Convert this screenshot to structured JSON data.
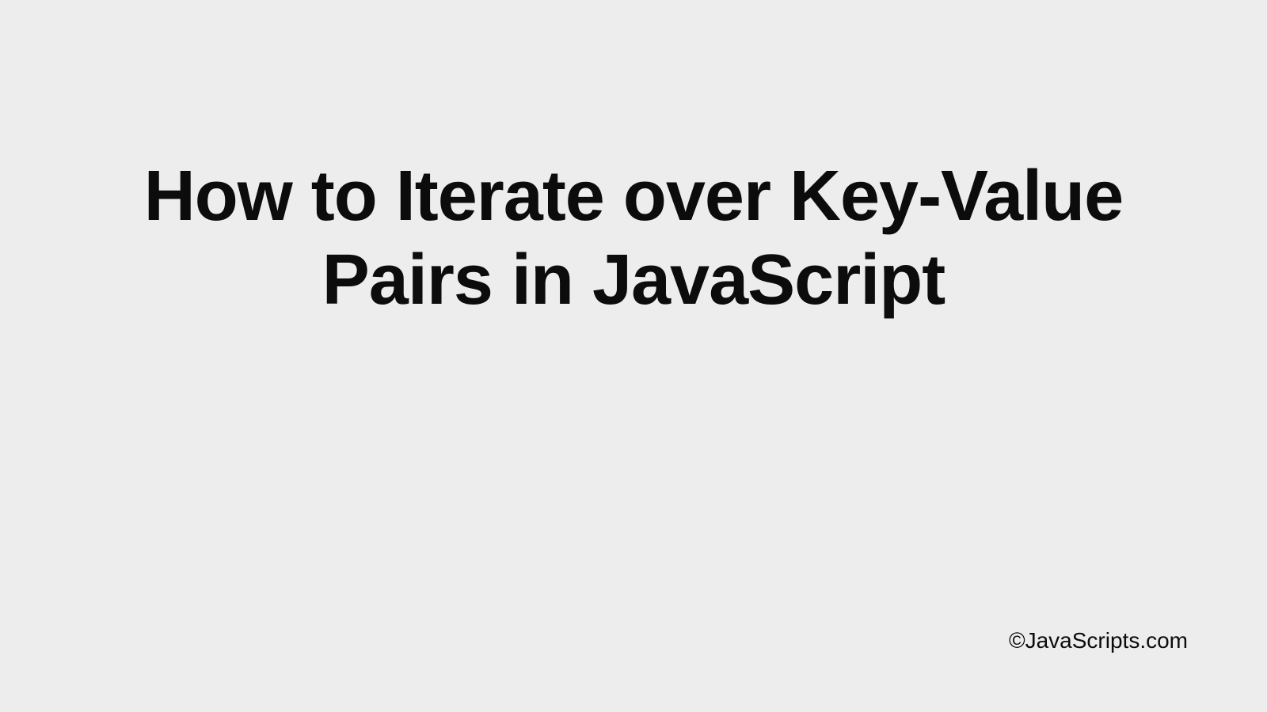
{
  "title": "How to Iterate over Key-Value Pairs in JavaScript",
  "footer": "©JavaScripts.com"
}
